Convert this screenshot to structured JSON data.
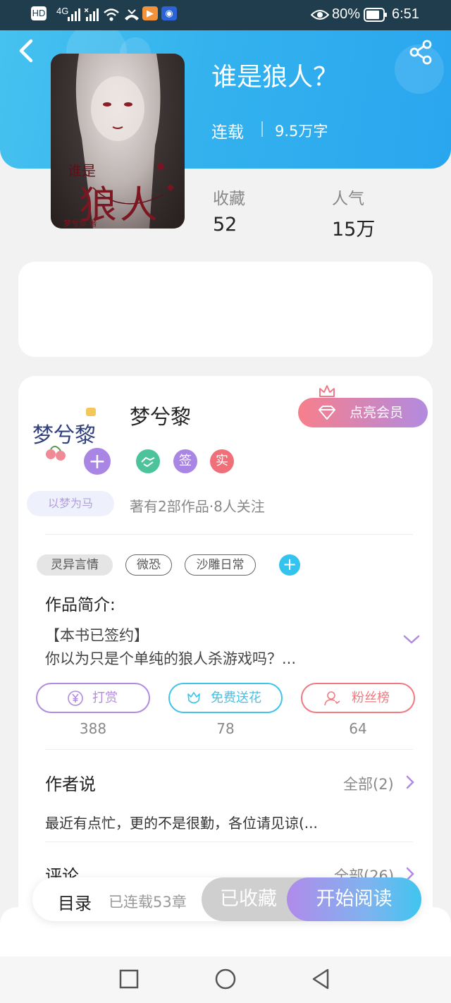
{
  "status_bar": {
    "left_icons": [
      "hd-icon",
      "signal-icon",
      "signal-x-icon",
      "wifi-icon",
      "missed-call-icon",
      "play-app-icon",
      "bulb-app-icon"
    ],
    "network": "4G",
    "battery": "80%",
    "time": "6:51"
  },
  "book": {
    "title": "谁是狼人？",
    "status": "连载",
    "word_count": "9.5万字",
    "cover_text_small": "谁是",
    "cover_text_big": "狼人",
    "cover_author": "梦兮黎 著",
    "stats": [
      {
        "label": "收藏",
        "value": "52"
      },
      {
        "label": "人气",
        "value": "15万"
      }
    ]
  },
  "author": {
    "name": "梦兮黎",
    "avatar_text": "梦兮黎",
    "avatar_tag": "以梦为马",
    "badges": [
      {
        "name": "handshake-badge",
        "text": "",
        "color": "#4cc39a"
      },
      {
        "name": "sign-badge",
        "text": "签",
        "color": "#a985e4"
      },
      {
        "name": "verified-badge",
        "text": "实",
        "color": "#f0707a"
      }
    ],
    "meta": "著有2部作品·8人关注",
    "vip_button": "点亮会员"
  },
  "tags": [
    "灵异言情",
    "微恐",
    "沙雕日常"
  ],
  "intro": {
    "heading": "作品简介:",
    "line1": "【本书已签约】",
    "line2": "你以为只是个单纯的狼人杀游戏吗？..."
  },
  "actions": [
    {
      "label": "打赏",
      "count": "388",
      "color": "#b28be0"
    },
    {
      "label": "免费送花",
      "count": "78",
      "color": "#3ec4ea"
    },
    {
      "label": "粉丝榜",
      "count": "64",
      "color": "#ef7a80"
    }
  ],
  "author_say": {
    "heading": "作者说",
    "more": "全部(2)",
    "text": "最近有点忙，更的不是很勤，各位请见谅(..."
  },
  "comments": {
    "heading": "评论",
    "more": "全部(26)"
  },
  "bottom_bar": {
    "toc_label": "目录",
    "chapter_count": "已连载53章",
    "collected": "已收藏",
    "start_reading": "开始阅读"
  },
  "colors": {
    "hero_blue": "#33b2ee",
    "accent_purple": "#a985e4",
    "accent_cyan": "#34c3ef",
    "accent_red": "#f0707a"
  }
}
